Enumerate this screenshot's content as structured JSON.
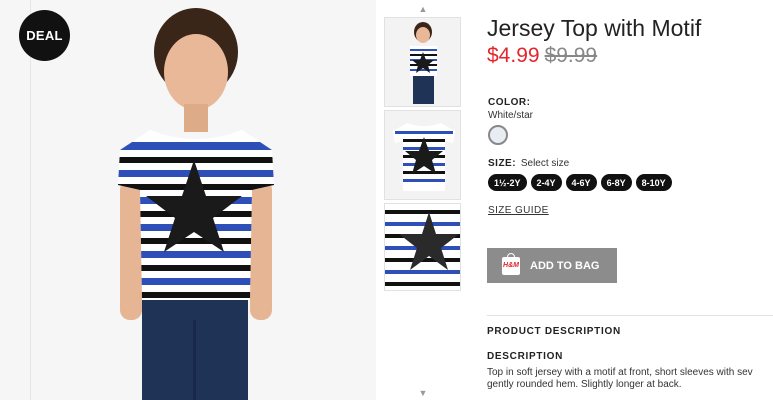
{
  "badge": {
    "label": "DEAL"
  },
  "product": {
    "title": "Jersey Top with Motif",
    "price_sale": "$4.99",
    "price_original": "$9.99",
    "color_label": "COLOR:",
    "color_value": "White/star",
    "size_label": "SIZE:",
    "size_prompt": "Select size",
    "sizes": [
      "1½-2Y",
      "2-4Y",
      "4-6Y",
      "6-8Y",
      "8-10Y"
    ],
    "size_guide": "SIZE GUIDE",
    "add_to_bag": "ADD TO BAG",
    "bag_icon_text": "H&M"
  },
  "description": {
    "section_heading": "PRODUCT DESCRIPTION",
    "heading": "DESCRIPTION",
    "line1": "Top in soft jersey with a motif at front, short sleeves with sev",
    "line2": "gently rounded hem. Slightly longer at back."
  },
  "thumbnails": {
    "up_arrow": "▲",
    "down_arrow": "▼"
  },
  "colors": {
    "sale_price": "#e4252c",
    "button_bg": "#8c8c8c",
    "stripe_blue": "#2f4fb8",
    "stripe_black": "#111111"
  }
}
